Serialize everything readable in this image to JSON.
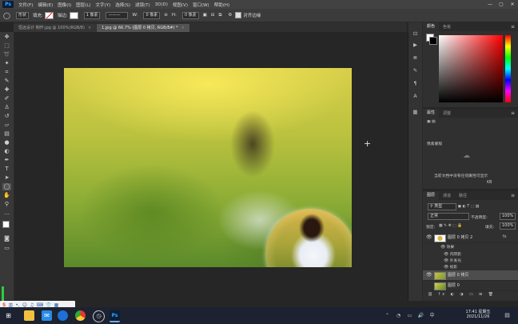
{
  "app": {
    "logo": "Ps"
  },
  "menubar": {
    "items": [
      "文件(F)",
      "编辑(E)",
      "图像(I)",
      "图层(L)",
      "文字(Y)",
      "选择(S)",
      "滤镜(T)",
      "3D(D)",
      "视图(V)",
      "窗口(W)",
      "帮助(H)"
    ]
  },
  "window_controls": {
    "minimize": "—",
    "maximize": "▢",
    "close": "✕"
  },
  "options": {
    "shape_mode": "形状",
    "fill_label": "填充:",
    "stroke_label": "描边:",
    "stroke_size": "1 像素",
    "width_label": "W:",
    "width_value": "0 像素",
    "link_icon": "⊖",
    "height_label": "H:",
    "height_value": "0 像素",
    "align_edges": "对齐边缘"
  },
  "tabs": [
    {
      "label": "恒远设计 制作.jpg @ 100%(RGB/8)",
      "close": "×"
    },
    {
      "label": "1.jpg @ 66.7% (图层 0 拷贝, RGB/8#) *",
      "close": "×"
    }
  ],
  "panels": {
    "color": {
      "tabs": [
        "颜色",
        "色板"
      ]
    },
    "properties": {
      "tabs": [
        "属性",
        "调整"
      ],
      "empty_title": "像素蒙版",
      "empty_hint": "当前文档中没有任何属性可显示",
      "unit": "KB"
    },
    "layers": {
      "tabs": [
        "图层",
        "通道",
        "路径"
      ],
      "search_label": "类型",
      "blend_mode": "正常",
      "opacity_label": "不透明度:",
      "opacity_value": "100%",
      "lock_label": "锁定:",
      "fill_label": "填充:",
      "fill_value": "100%",
      "rows": [
        {
          "name": "图层 0 拷贝 2",
          "fx": "fx"
        },
        {
          "name": "图层 0 拷贝"
        },
        {
          "name": "图层 0"
        }
      ],
      "effects": {
        "title": "效果",
        "items": [
          "内阴影",
          "外发光",
          "投影"
        ]
      }
    }
  },
  "taskbar": {
    "ime_lang": "英",
    "time": "17:41",
    "weekday": "星期五",
    "date": "2021/11/26"
  }
}
